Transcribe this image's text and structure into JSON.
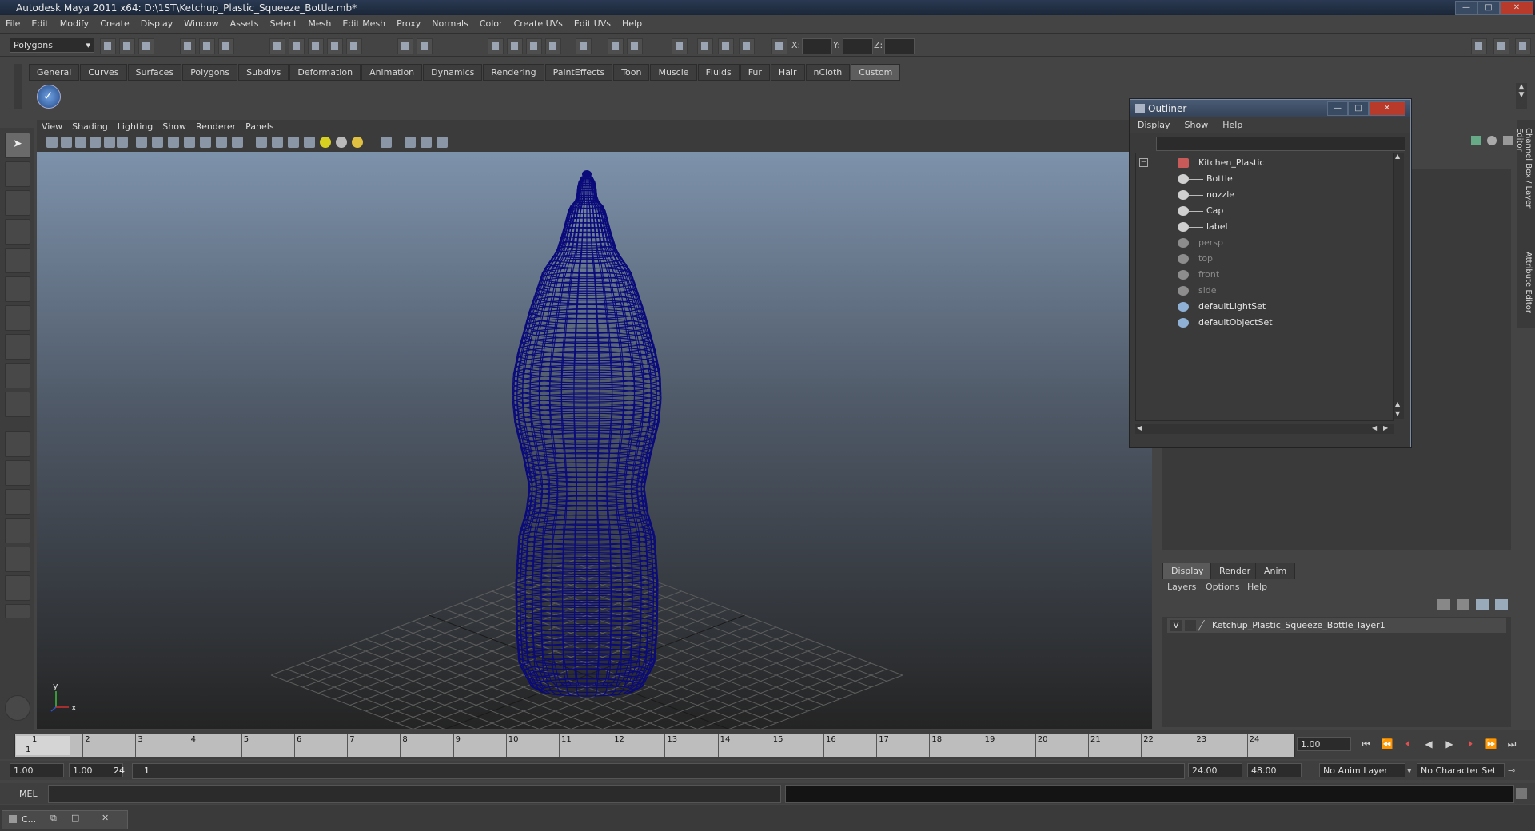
{
  "window": {
    "title": "Autodesk Maya 2011 x64: D:\\1ST\\Ketchup_Plastic_Squeeze_Bottle.mb*",
    "minimize": "—",
    "maximize": "□",
    "close": "✕"
  },
  "menubar": [
    "File",
    "Edit",
    "Modify",
    "Create",
    "Display",
    "Window",
    "Assets",
    "Select",
    "Mesh",
    "Edit Mesh",
    "Proxy",
    "Normals",
    "Color",
    "Create UVs",
    "Edit UVs",
    "Help"
  ],
  "statusline": {
    "mode": "Polygons",
    "x_label": "X:",
    "y_label": "Y:",
    "z_label": "Z:"
  },
  "shelf_tabs": [
    "General",
    "Curves",
    "Surfaces",
    "Polygons",
    "Subdivs",
    "Deformation",
    "Animation",
    "Dynamics",
    "Rendering",
    "PaintEffects",
    "Toon",
    "Muscle",
    "Fluids",
    "Fur",
    "Hair",
    "nCloth",
    "Custom"
  ],
  "shelf_active": "Custom",
  "viewport": {
    "menus": [
      "View",
      "Shading",
      "Lighting",
      "Show",
      "Renderer",
      "Panels"
    ],
    "axis_y": "y",
    "axis_x": "x",
    "wire_color": "#0a0a7a"
  },
  "outliner": {
    "title": "Outliner",
    "menus": [
      "Display",
      "Show",
      "Help"
    ],
    "root": "Kitchen_Plastic",
    "children": [
      "Bottle",
      "nozzle",
      "Cap",
      "label"
    ],
    "cameras": [
      "persp",
      "top",
      "front",
      "side"
    ],
    "sets": [
      "defaultLightSet",
      "defaultObjectSet"
    ]
  },
  "layers": {
    "tabs": [
      "Display",
      "Render",
      "Anim"
    ],
    "active_tab": "Display",
    "menus": [
      "Layers",
      "Options",
      "Help"
    ],
    "layer_v": "V",
    "layer_name": "Ketchup_Plastic_Squeeze_Bottle_layer1"
  },
  "right_strip": {
    "channel_box": "Channel Box / Layer Editor",
    "attribute_editor": "Attribute Editor"
  },
  "timeline": {
    "ticks": [
      "1",
      "2",
      "3",
      "4",
      "5",
      "6",
      "7",
      "8",
      "9",
      "10",
      "11",
      "12",
      "13",
      "14",
      "15",
      "16",
      "17",
      "18",
      "19",
      "20",
      "21",
      "22",
      "23",
      "24"
    ],
    "current_frame_marker": "1",
    "current_time": "1.00"
  },
  "range": {
    "start": "1.00",
    "playback_start": "1.00",
    "slider_start": "1",
    "slider_end": "24",
    "playback_end": "24.00",
    "end": "48.00",
    "anim_layer": "No Anim Layer",
    "character_set": "No Character Set"
  },
  "command": {
    "label": "MEL"
  },
  "taskbar": {
    "item": "C..."
  }
}
